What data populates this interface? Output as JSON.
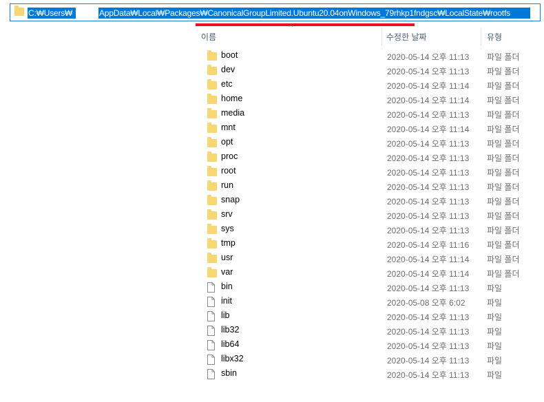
{
  "address": {
    "segment1": "C:₩Users₩",
    "segment2": "AppData₩Local₩Packages₩CanonicalGroupLimited.Ubuntu20.04onWindows_79rhkp1fndgsc₩LocalState₩rootfs"
  },
  "columns": {
    "name": "이름",
    "date": "수정한 날짜",
    "type": "유형"
  },
  "files": [
    {
      "name": "boot",
      "date": "2020-05-14 오후 11:13",
      "type": "파일 폴더",
      "kind": "folder"
    },
    {
      "name": "dev",
      "date": "2020-05-14 오후 11:13",
      "type": "파일 폴더",
      "kind": "folder"
    },
    {
      "name": "etc",
      "date": "2020-05-14 오후 11:14",
      "type": "파일 폴더",
      "kind": "folder"
    },
    {
      "name": "home",
      "date": "2020-05-14 오후 11:14",
      "type": "파일 폴더",
      "kind": "folder"
    },
    {
      "name": "media",
      "date": "2020-05-14 오후 11:13",
      "type": "파일 폴더",
      "kind": "folder"
    },
    {
      "name": "mnt",
      "date": "2020-05-14 오후 11:14",
      "type": "파일 폴더",
      "kind": "folder"
    },
    {
      "name": "opt",
      "date": "2020-05-14 오후 11:13",
      "type": "파일 폴더",
      "kind": "folder"
    },
    {
      "name": "proc",
      "date": "2020-05-14 오후 11:13",
      "type": "파일 폴더",
      "kind": "folder"
    },
    {
      "name": "root",
      "date": "2020-05-14 오후 11:13",
      "type": "파일 폴더",
      "kind": "folder"
    },
    {
      "name": "run",
      "date": "2020-05-14 오후 11:13",
      "type": "파일 폴더",
      "kind": "folder"
    },
    {
      "name": "snap",
      "date": "2020-05-14 오후 11:13",
      "type": "파일 폴더",
      "kind": "folder"
    },
    {
      "name": "srv",
      "date": "2020-05-14 오후 11:13",
      "type": "파일 폴더",
      "kind": "folder"
    },
    {
      "name": "sys",
      "date": "2020-05-14 오후 11:13",
      "type": "파일 폴더",
      "kind": "folder"
    },
    {
      "name": "tmp",
      "date": "2020-05-14 오후 11:16",
      "type": "파일 폴더",
      "kind": "folder"
    },
    {
      "name": "usr",
      "date": "2020-05-14 오후 11:14",
      "type": "파일 폴더",
      "kind": "folder"
    },
    {
      "name": "var",
      "date": "2020-05-14 오후 11:14",
      "type": "파일 폴더",
      "kind": "folder"
    },
    {
      "name": "bin",
      "date": "2020-05-14 오후 11:13",
      "type": "파일",
      "kind": "file"
    },
    {
      "name": "init",
      "date": "2020-05-08 오후 6:02",
      "type": "파일",
      "kind": "file"
    },
    {
      "name": "lib",
      "date": "2020-05-14 오후 11:13",
      "type": "파일",
      "kind": "file"
    },
    {
      "name": "lib32",
      "date": "2020-05-14 오후 11:13",
      "type": "파일",
      "kind": "file"
    },
    {
      "name": "lib64",
      "date": "2020-05-14 오후 11:13",
      "type": "파일",
      "kind": "file"
    },
    {
      "name": "libx32",
      "date": "2020-05-14 오후 11:13",
      "type": "파일",
      "kind": "file"
    },
    {
      "name": "sbin",
      "date": "2020-05-14 오후 11:13",
      "type": "파일",
      "kind": "file"
    }
  ],
  "colors": {
    "selection": "#0078d7",
    "highlight_underline": "#e81123",
    "folder": "#f7d674"
  }
}
